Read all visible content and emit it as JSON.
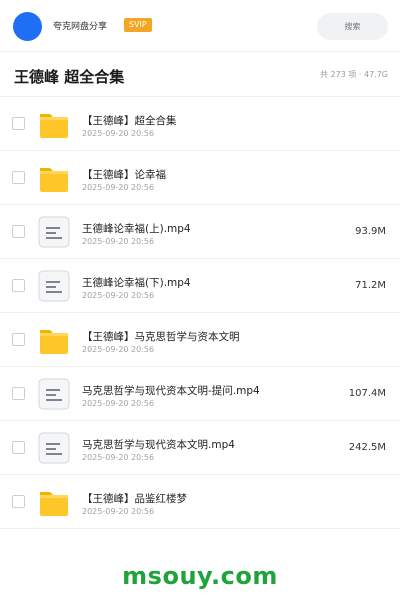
{
  "header": {
    "share_title": "夸克网盘分享",
    "badge": "SVIP",
    "search_placeholder": "搜索"
  },
  "title_bar": {
    "title": "王德峰 超全合集",
    "summary": "共 273 项 · 47.7G"
  },
  "files": [
    {
      "type": "folder",
      "name": "【王德峰】超全合集",
      "date": "2025-09-20 20:56",
      "size": ""
    },
    {
      "type": "folder",
      "name": "【王德峰】论幸福",
      "date": "2025-09-20 20:56",
      "size": ""
    },
    {
      "type": "file",
      "name": "王德峰论幸福(上).mp4",
      "date": "2025-09-20 20:56",
      "size": "93.9M"
    },
    {
      "type": "file",
      "name": "王德峰论幸福(下).mp4",
      "date": "2025-09-20 20:56",
      "size": "71.2M"
    },
    {
      "type": "folder",
      "name": "【王德峰】马克思哲学与资本文明",
      "date": "2025-09-20 20:56",
      "size": ""
    },
    {
      "type": "file",
      "name": "马克思哲学与现代资本文明-提问.mp4",
      "date": "2025-09-20 20:56",
      "size": "107.4M"
    },
    {
      "type": "file",
      "name": "马克思哲学与现代资本文明.mp4",
      "date": "2025-09-20 20:56",
      "size": "242.5M"
    },
    {
      "type": "folder",
      "name": "【王德峰】品鉴红楼梦",
      "date": "2025-09-20 20:56",
      "size": ""
    }
  ],
  "icons": {
    "folder": "folder-icon",
    "file": "video-file-icon"
  },
  "colors": {
    "avatar": "#1f6ff5",
    "badge": "#f5a524",
    "folder": "#ffc629",
    "watermark": "#1fa33a"
  },
  "watermark": "msouy.com"
}
